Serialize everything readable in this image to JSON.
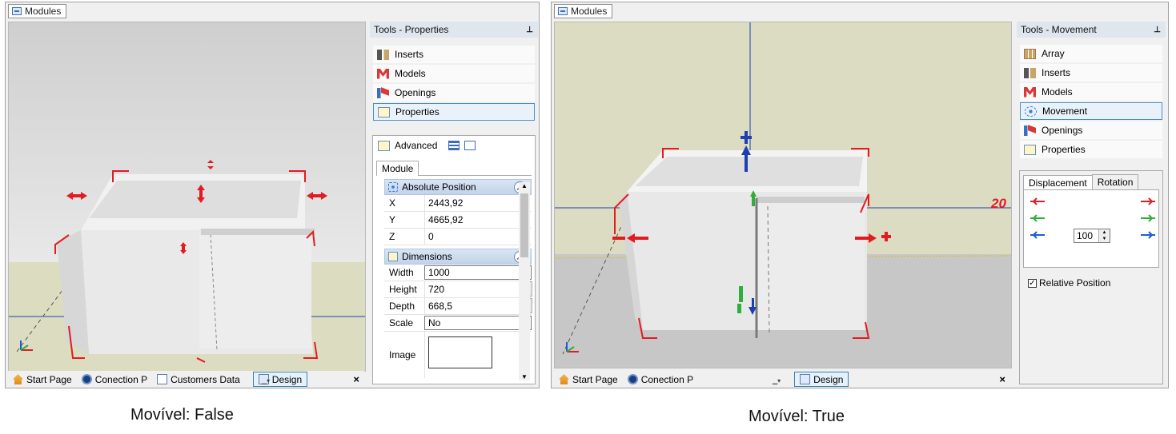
{
  "left": {
    "doc_tab": "Modules",
    "panel_title": "Tools - Properties",
    "tools": [
      {
        "label": "Inserts",
        "icon": "inserts-icon"
      },
      {
        "label": "Models",
        "icon": "models-icon"
      },
      {
        "label": "Openings",
        "icon": "openings-icon"
      },
      {
        "label": "Properties",
        "icon": "properties-icon",
        "selected": true
      }
    ],
    "advanced_label": "Advanced",
    "tab_module": "Module",
    "section_abs": "Absolute Position",
    "abs_rows": [
      {
        "k": "X",
        "v": "2443,92"
      },
      {
        "k": "Y",
        "v": "4665,92"
      },
      {
        "k": "Z",
        "v": "0"
      }
    ],
    "section_dims": "Dimensions",
    "dims_rows": [
      {
        "k": "Width",
        "v": "1000"
      },
      {
        "k": "Height",
        "v": "720"
      },
      {
        "k": "Depth",
        "v": "668,5"
      },
      {
        "k": "Scale",
        "v": "No"
      }
    ],
    "image_label": "Image",
    "bottom_tabs": [
      "Start Page",
      "Conection P",
      "Customers Data",
      "Design"
    ],
    "close": "×",
    "caption": "Movível: False"
  },
  "right": {
    "doc_tab": "Modules",
    "panel_title": "Tools - Movement",
    "tools": [
      {
        "label": "Array",
        "icon": "array-icon"
      },
      {
        "label": "Inserts",
        "icon": "inserts-icon"
      },
      {
        "label": "Models",
        "icon": "models-icon"
      },
      {
        "label": "Movement",
        "icon": "movement-icon",
        "selected": true
      },
      {
        "label": "Openings",
        "icon": "openings-icon"
      },
      {
        "label": "Properties",
        "icon": "properties-icon"
      }
    ],
    "tab_displacement": "Displacement",
    "tab_rotation": "Rotation",
    "step_value": "100",
    "relative_position": "Relative Position",
    "viewport_label": "20",
    "bottom_tabs": [
      "Start Page",
      "Conection P",
      "Design"
    ],
    "close": "×",
    "caption": "Movível: True"
  },
  "colors": {
    "x_axis": "#d9202a",
    "y_axis": "#2fae3a",
    "z_axis": "#1e5bd6",
    "selection": "#4b8ec6"
  }
}
